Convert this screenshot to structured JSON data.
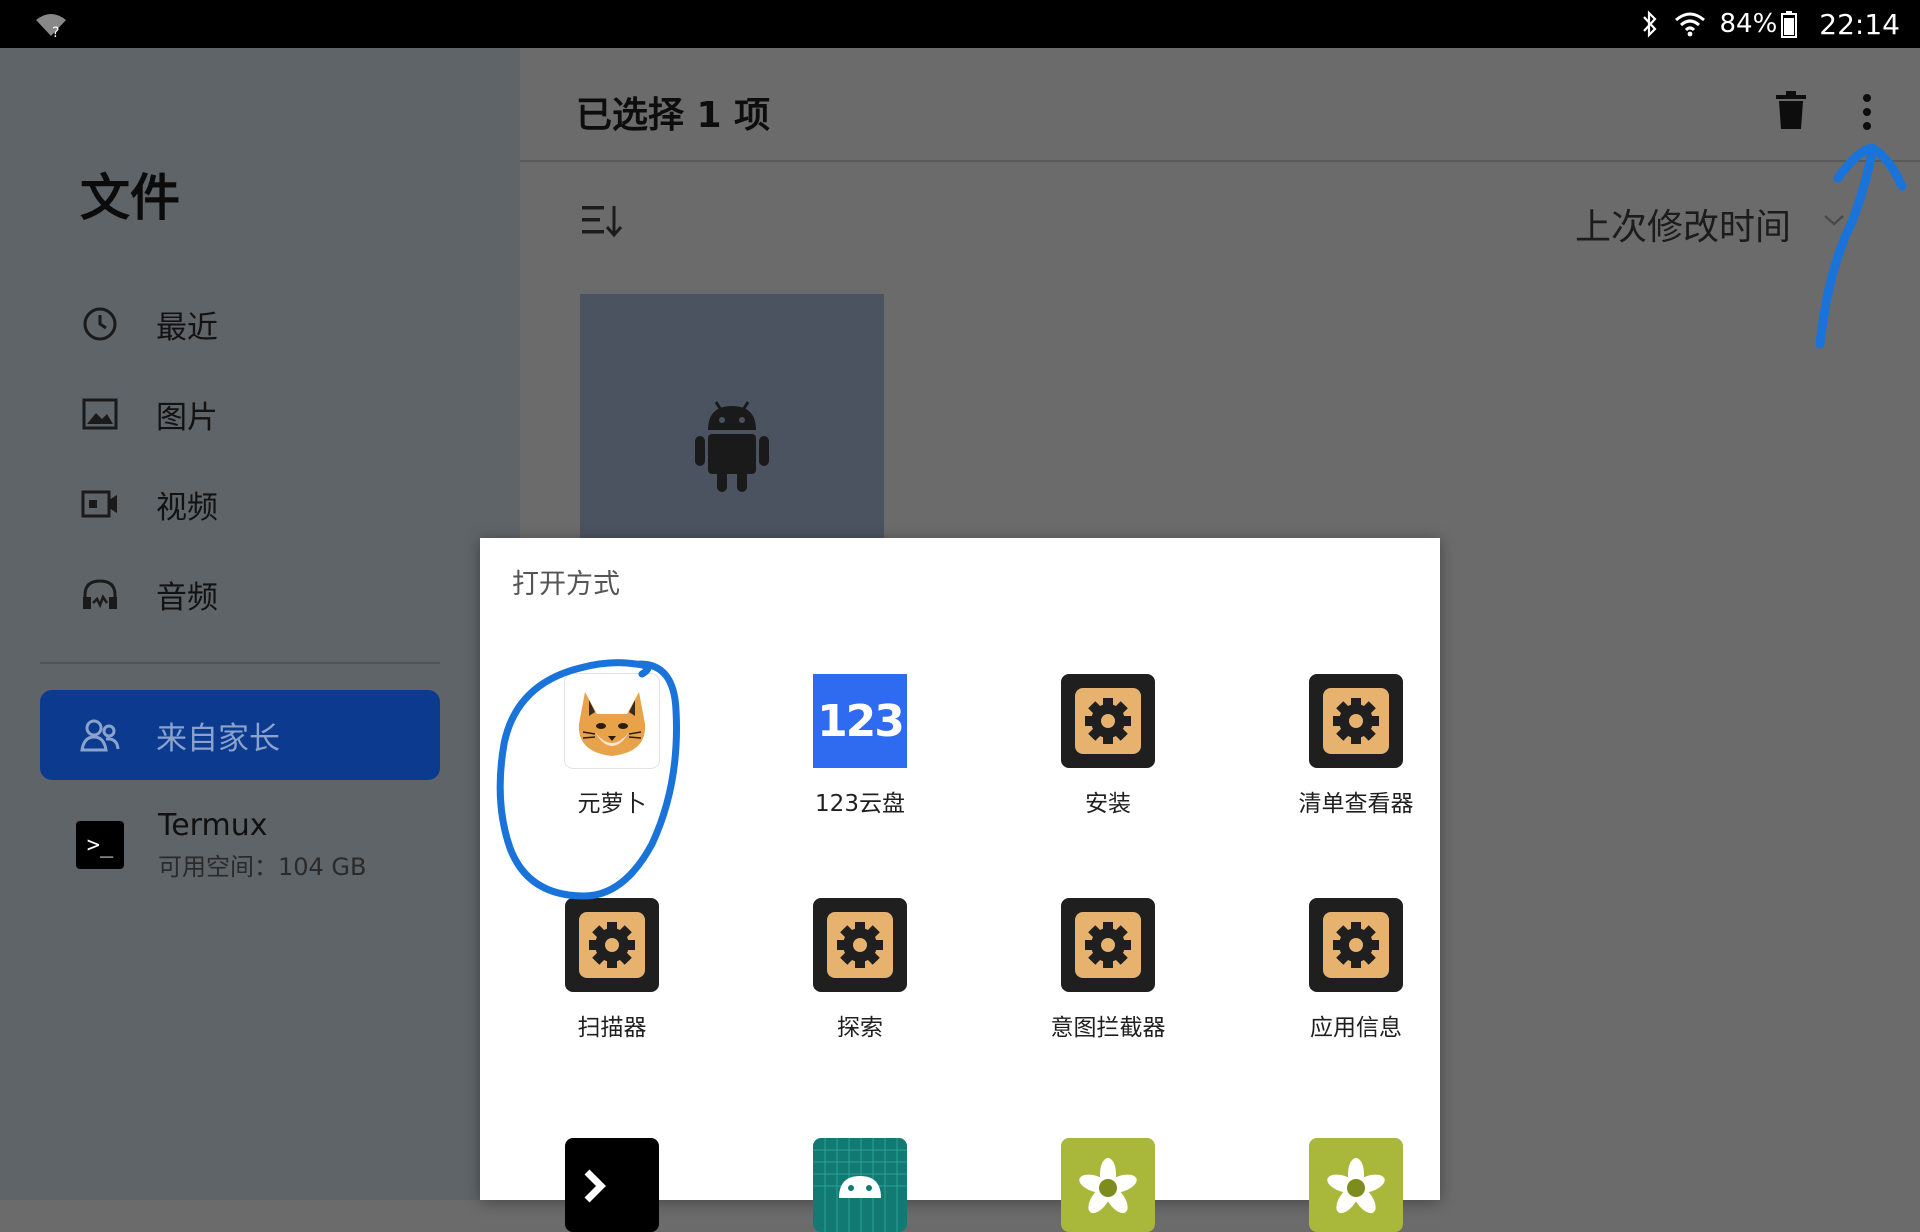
{
  "status_bar": {
    "battery": "84%",
    "time": "22:14"
  },
  "sidebar": {
    "title": "文件",
    "items": [
      {
        "label": "最近",
        "icon": "clock-icon"
      },
      {
        "label": "图片",
        "icon": "image-icon"
      },
      {
        "label": "视频",
        "icon": "video-icon"
      },
      {
        "label": "音频",
        "icon": "headphones-icon"
      }
    ],
    "active_item": {
      "label": "来自家长",
      "icon": "family-icon"
    },
    "storage": {
      "name": "Termux",
      "free": "可用空间：104 GB",
      "icon": "termux-icon"
    }
  },
  "toolbar": {
    "selection_title": "已选择 1 项",
    "sort_label": "上次修改时间"
  },
  "dialog": {
    "title": "打开方式",
    "apps": [
      {
        "label": "元萝卜",
        "icon": "lynx-icon"
      },
      {
        "label": "123云盘",
        "icon": "123-cloud-icon",
        "icon_text": "123"
      },
      {
        "label": "安装",
        "icon": "gear-icon"
      },
      {
        "label": "清单查看器",
        "icon": "gear-icon"
      },
      {
        "label": "扫描器",
        "icon": "gear-icon"
      },
      {
        "label": "探索",
        "icon": "gear-icon"
      },
      {
        "label": "意图拦截器",
        "icon": "gear-icon"
      },
      {
        "label": "应用信息",
        "icon": "gear-icon"
      }
    ]
  },
  "colors": {
    "accent_active": "#0b3a8f",
    "annotation_blue": "#1a73d9",
    "gear_orange": "#e7b16e"
  }
}
